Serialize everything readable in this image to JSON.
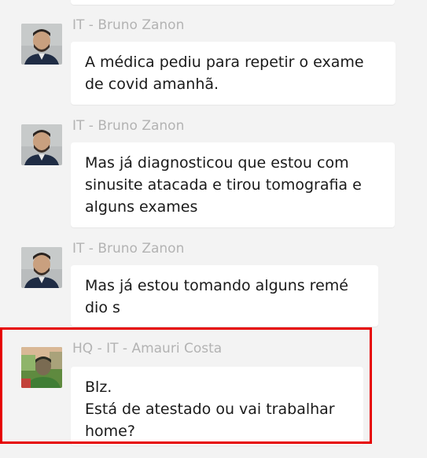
{
  "messages": [
    {
      "sender": "IT - Bruno Zanon",
      "text": "A médica pediu para repetir o exame\nde covid amanhã.",
      "avatar": "person-photo"
    },
    {
      "sender": "IT - Bruno Zanon",
      "text": "Mas já diagnosticou que estou com\nsinusite atacada e tirou tomografia e\nalguns exames",
      "avatar": "person-photo"
    },
    {
      "sender": "IT - Bruno Zanon",
      "text": "Mas já estou tomando alguns remé\ndio s",
      "avatar": "person-photo"
    },
    {
      "sender": "HQ - IT - Amauri Costa",
      "text": "Blz.\nEstá de atestado ou vai trabalhar\nhome?",
      "avatar": "person-photo-green"
    }
  ],
  "highlight_color": "#e60000"
}
